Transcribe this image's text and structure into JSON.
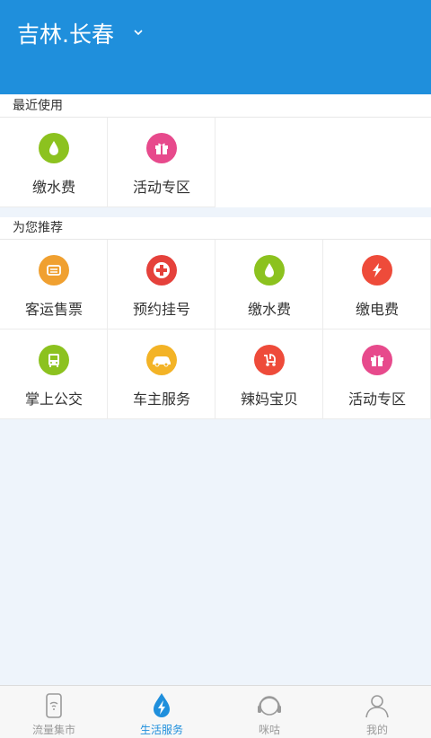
{
  "header": {
    "city": "吉林.长春"
  },
  "recent": {
    "title": "最近使用",
    "items": [
      {
        "label": "缴水费",
        "icon": "water-drop-icon",
        "color": "#8cc21f"
      },
      {
        "label": "活动专区",
        "icon": "gift-icon",
        "color": "#e74a8c"
      }
    ]
  },
  "recommend": {
    "title": "为您推荐",
    "items": [
      {
        "label": "客运售票",
        "icon": "ticket-icon",
        "color": "#f0a030"
      },
      {
        "label": "预约挂号",
        "icon": "medical-cross-icon",
        "color": "#e5413b"
      },
      {
        "label": "缴水费",
        "icon": "water-drop-icon",
        "color": "#8cc21f"
      },
      {
        "label": "缴电费",
        "icon": "lightning-icon",
        "color": "#ee4b3a"
      },
      {
        "label": "掌上公交",
        "icon": "bus-icon",
        "color": "#8cc21f"
      },
      {
        "label": "车主服务",
        "icon": "car-icon",
        "color": "#f3b326"
      },
      {
        "label": "辣妈宝贝",
        "icon": "stroller-icon",
        "color": "#ee4b3a"
      },
      {
        "label": "活动专区",
        "icon": "gift-icon",
        "color": "#e74a8c"
      }
    ]
  },
  "tabbar": {
    "items": [
      {
        "label": "流量集市",
        "icon": "phone-signal-icon",
        "active": false
      },
      {
        "label": "生活服务",
        "icon": "lightning-drop-icon",
        "active": true
      },
      {
        "label": "咪咕",
        "icon": "headphones-icon",
        "active": false
      },
      {
        "label": "我的",
        "icon": "user-icon",
        "active": false
      }
    ]
  },
  "colors": {
    "brand": "#1f8fdc",
    "background": "#eef4fb"
  }
}
